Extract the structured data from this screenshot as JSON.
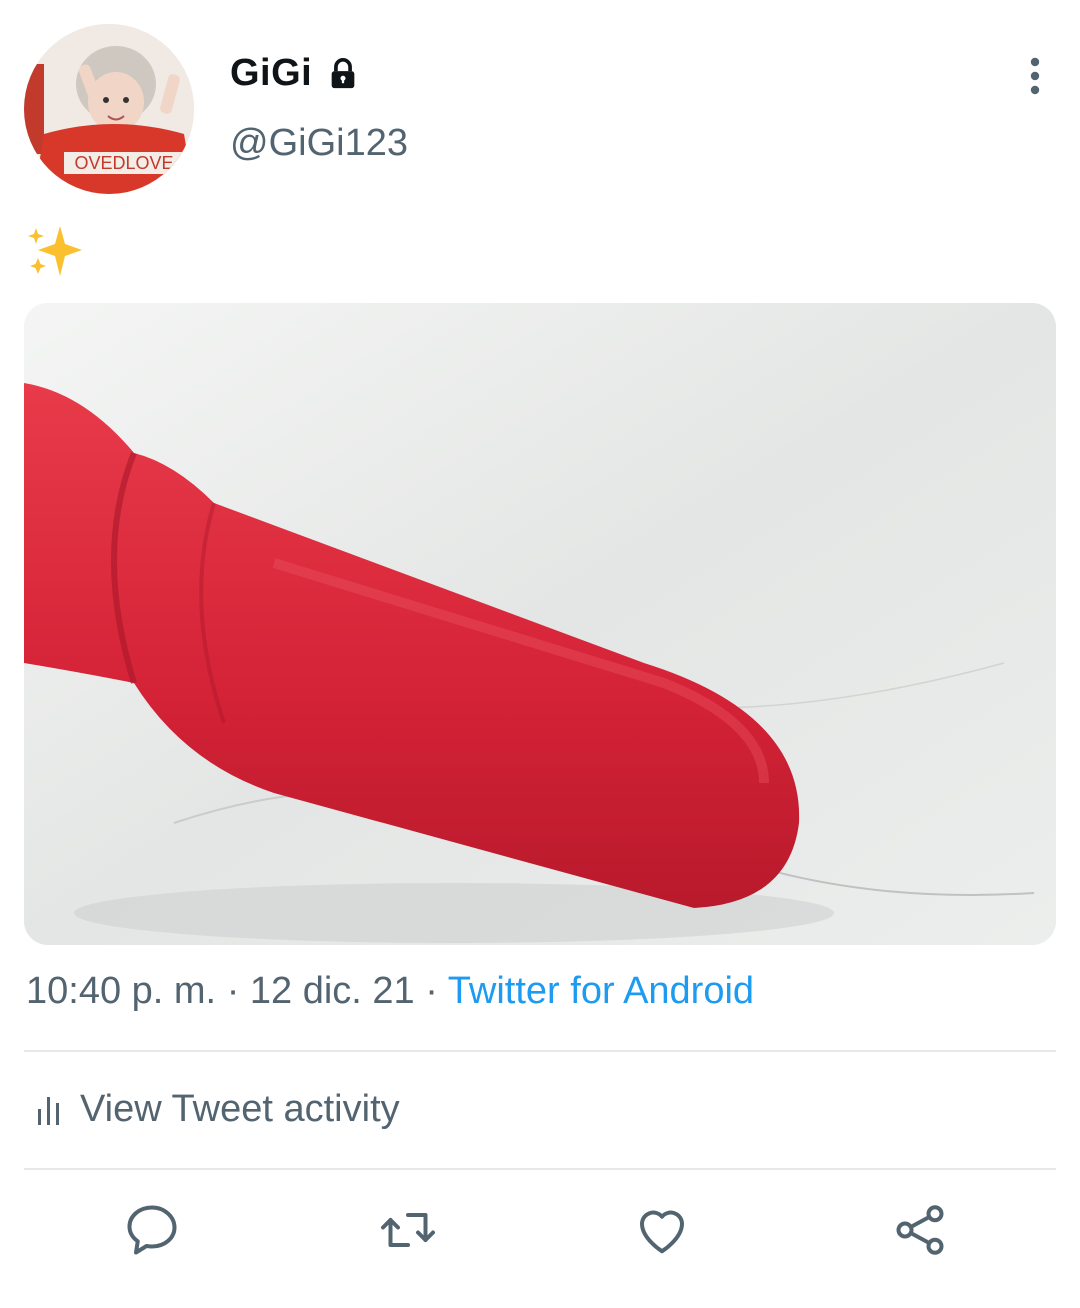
{
  "user": {
    "display_name": "GiGi",
    "handle": "@GiGi123",
    "protected_icon": "lock-icon",
    "avatar_caption": "OVEDLOVE"
  },
  "tweet": {
    "text_icon": "sparkles-emoji",
    "time": "10:40 p. m.",
    "date": "12 dic. 21",
    "separator": "·",
    "source": "Twitter for Android"
  },
  "activity": {
    "label": "View Tweet activity",
    "icon": "bar-chart-icon"
  },
  "actions": [
    {
      "icon": "reply-icon"
    },
    {
      "icon": "retweet-icon"
    },
    {
      "icon": "like-icon"
    },
    {
      "icon": "share-icon"
    }
  ],
  "colors": {
    "link": "#1d9bf0",
    "secondary_text": "#536471",
    "object_red": "#d9263a"
  }
}
